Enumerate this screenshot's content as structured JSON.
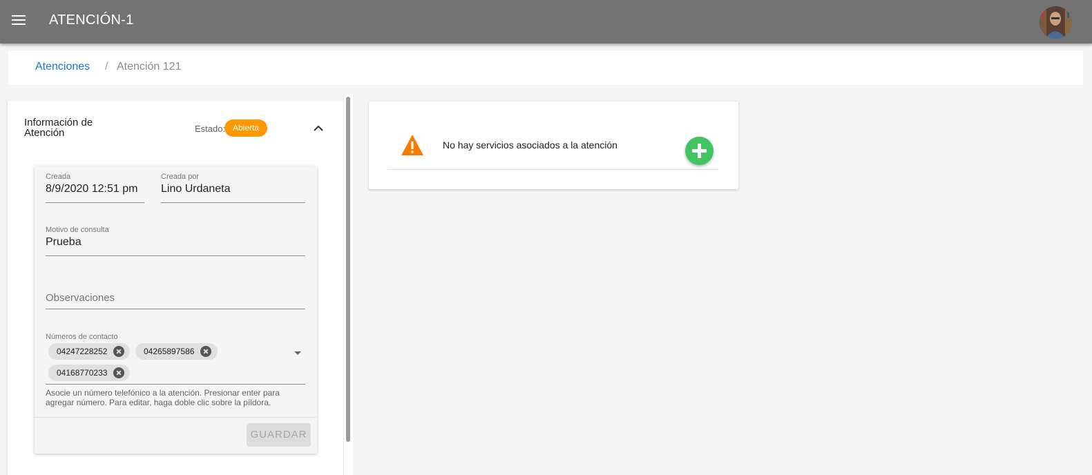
{
  "app": {
    "title": "ATENCIÓN-1"
  },
  "breadcrumb": {
    "parent": "Atenciones",
    "separator": "/",
    "current": "Atención 121"
  },
  "info_panel": {
    "title": "Información de Atención",
    "estado_label": "Estado:",
    "estado_value": "Abierta",
    "estado_color": "#ff9800"
  },
  "form": {
    "creada_label": "Creada",
    "creada_value": "8/9/2020 12:51 pm",
    "creada_por_label": "Creada por",
    "creada_por_value": "Lino Urdaneta",
    "motivo_label": "Motivo de consulta",
    "motivo_value": "Prueba",
    "observaciones_placeholder": "Observaciones",
    "numeros_label": "Números de contacto",
    "numeros": [
      "04247228252",
      "04265897586",
      "04168770233"
    ],
    "numeros_hint": "Asocie un número telefónico a la atención. Presionar enter para agregar número. Para editar, haga doble clic sobre la píldora.",
    "save_label": "GUARDAR"
  },
  "services": {
    "empty_message": "No hay servicios asociados a la atención",
    "warning_color": "#f57c00",
    "add_color": "#43c463"
  }
}
